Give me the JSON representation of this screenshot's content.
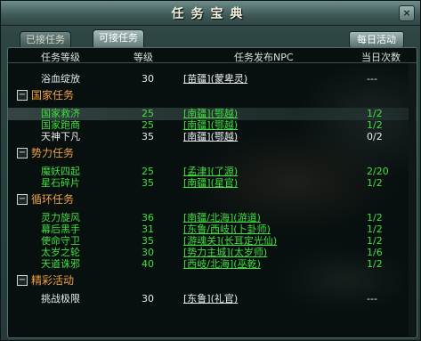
{
  "window": {
    "title": "任务宝典",
    "close": "×"
  },
  "tabs": [
    {
      "label": "已接任务"
    },
    {
      "label": "可接任务"
    }
  ],
  "daily_button": "每日活动",
  "columns": {
    "name": "任务等级",
    "level": "等级",
    "npc": "任务发布NPC",
    "count": "当日次数"
  },
  "rows": [
    {
      "name": "浴血绽放",
      "level": "30",
      "npc": "[苗疆](蒙卑灵)",
      "count": "---",
      "color": "white"
    },
    {
      "category": "国家任务"
    },
    {
      "name": "国家救济",
      "level": "25",
      "npc": "[南疆](鄂越)",
      "count": "1/2",
      "color": "green",
      "selected": true
    },
    {
      "name": "国家跑商",
      "level": "25",
      "npc": "[南疆](鄂越)",
      "count": "1/2",
      "color": "green"
    },
    {
      "name": "天神下凡",
      "level": "35",
      "npc": "[南疆](鄂越)",
      "count": "0/2",
      "color": "white"
    },
    {
      "category": "势力任务"
    },
    {
      "name": "魔妖四起",
      "level": "25",
      "npc": "[孟津](了源)",
      "count": "2/20",
      "color": "green"
    },
    {
      "name": "星石碎片",
      "level": "35",
      "npc": "[南疆](星官)",
      "count": "1/2",
      "color": "green"
    },
    {
      "category": "循环任务"
    },
    {
      "name": "灵力旋风",
      "level": "36",
      "npc": "[南疆/北海](游道)",
      "count": "1/2",
      "color": "green"
    },
    {
      "name": "幕后黑手",
      "level": "31",
      "npc": "[东鲁/西岐](卜卦师)",
      "count": "1/2",
      "color": "green"
    },
    {
      "name": "使命守卫",
      "level": "35",
      "npc": "[游魂关](长耳定光仙)",
      "count": "1/2",
      "color": "green"
    },
    {
      "name": "太岁之轮",
      "level": "30",
      "npc": "[势力主城](太岁师)",
      "count": "1/6",
      "color": "green"
    },
    {
      "name": "天道诛邪",
      "level": "40",
      "npc": "[西岐/北海](巫乾)",
      "count": "1/2",
      "color": "green"
    },
    {
      "category": "精彩活动"
    },
    {
      "name": "挑战极限",
      "level": "30",
      "npc": "[东鲁](礼官)",
      "count": "---",
      "color": "white"
    }
  ]
}
